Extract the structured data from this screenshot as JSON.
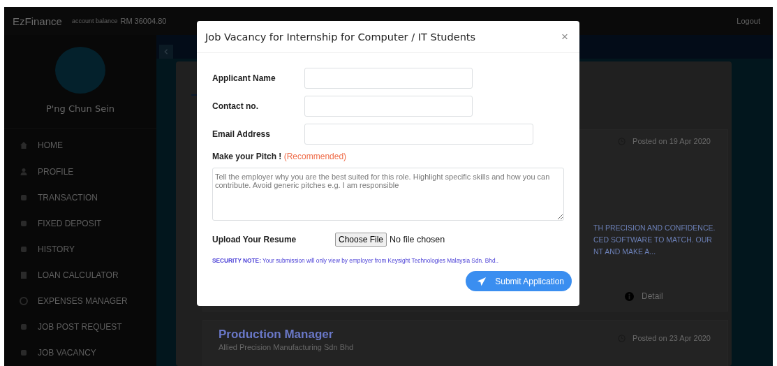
{
  "topbar": {
    "brand": "EzFinance",
    "balance_label": "account balance",
    "balance": "RM 36004.80",
    "logout": "Logout"
  },
  "sidebar": {
    "user_name": "P'ng Chun Sein",
    "items": [
      {
        "label": "HOME"
      },
      {
        "label": "PROFILE"
      },
      {
        "label": "TRANSACTION"
      },
      {
        "label": "FIXED DEPOSIT"
      },
      {
        "label": "HISTORY"
      },
      {
        "label": "LOAN CALCULATOR"
      },
      {
        "label": "EXPENSES MANAGER"
      },
      {
        "label": "JOB POST REQUEST"
      },
      {
        "label": "JOB VACANCY"
      }
    ]
  },
  "jobs": [
    {
      "posted": "Posted on 19 Apr 2020",
      "description_lines": [
        "TH PRECISION AND CONFIDENCE.",
        "CED SOFTWARE TO MATCH. OUR",
        "NT AND MAKE A..."
      ],
      "detail": "Detail"
    },
    {
      "title": "Production Manager",
      "company": "Allied Precision Manufacturing Sdn Bhd",
      "posted": "Posted on 23 Apr 2020"
    }
  ],
  "modal": {
    "title": "Job Vacancy for Internship for Computer / IT Students",
    "close": "×",
    "fields": [
      {
        "label": "Applicant Name",
        "kind": "text"
      },
      {
        "label": "Contact no.",
        "kind": "text"
      },
      {
        "label": "Email Address",
        "kind": "email"
      }
    ],
    "pitch": {
      "label": "Make your Pitch !",
      "note": "(Recommended)",
      "placeholder": "Tell the employer why you are the best suited for this role. Highlight specific skills and how you can contribute. Avoid generic pitches e.g. I am responsible"
    },
    "upload": {
      "label": "Upload Your Resume",
      "button": "Choose File",
      "status": "No file chosen"
    },
    "security_note": "**SECURITY NOTE:** Your submission will only view by employer from Keysight Technologies Malaysia Sdn. Bhd..",
    "submit": "Submit Application"
  }
}
